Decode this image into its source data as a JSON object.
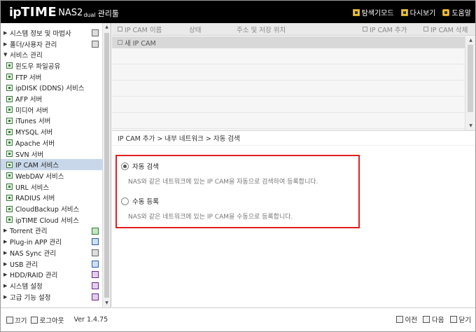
{
  "header": {
    "logo_ip": "ip",
    "logo_time": "TIME",
    "logo_nas": "NAS2",
    "logo_dual": "dual",
    "logo_mgr": "관리툴",
    "links": [
      {
        "label": "탐색기모드",
        "icon": "explorer-icon"
      },
      {
        "label": "다시보기",
        "icon": "refresh-icon"
      },
      {
        "label": "도움말",
        "icon": "help-icon"
      }
    ]
  },
  "sidebar": {
    "items": [
      {
        "label": "시스템 정보 및 마법사",
        "level": 1,
        "arrow": "▶",
        "icon": "chart-icon"
      },
      {
        "label": "폴더/사용자 관리",
        "level": 1,
        "arrow": "▶",
        "icon": "folder-icon"
      },
      {
        "label": "서비스 관리",
        "level": 1,
        "arrow": "▼"
      },
      {
        "label": "윈도우 파일공유",
        "level": 2
      },
      {
        "label": "FTP 서버",
        "level": 2
      },
      {
        "label": "ipDISK (DDNS) 서비스",
        "level": 2
      },
      {
        "label": "AFP 서버",
        "level": 2
      },
      {
        "label": "미디어 서버",
        "level": 2
      },
      {
        "label": "iTunes 서버",
        "level": 2
      },
      {
        "label": "MYSQL 서버",
        "level": 2
      },
      {
        "label": "Apache 서버",
        "level": 2
      },
      {
        "label": "SVN 서버",
        "level": 2
      },
      {
        "label": "IP CAM 서비스",
        "level": 2,
        "active": true
      },
      {
        "label": "WebDAV 서비스",
        "level": 2
      },
      {
        "label": "URL 서비스",
        "level": 2
      },
      {
        "label": "RADIUS 서버",
        "level": 2
      },
      {
        "label": "CloudBackup 서비스",
        "level": 2
      },
      {
        "label": "ipTIME Cloud 서비스",
        "level": 2
      },
      {
        "label": "Torrent 관리",
        "level": 1,
        "arrow": "▶",
        "icon": "torrent-icon"
      },
      {
        "label": "Plug-in APP 관리",
        "level": 1,
        "arrow": "▶",
        "icon": "plugin-icon"
      },
      {
        "label": "NAS Sync 관리",
        "level": 1,
        "arrow": "▶",
        "icon": "sync-icon"
      },
      {
        "label": "USB 관리",
        "level": 1,
        "arrow": "▶",
        "icon": "usb-icon"
      },
      {
        "label": "HDD/RAID 관리",
        "level": 1,
        "arrow": "▶",
        "icon": "hdd-icon"
      },
      {
        "label": "시스템 설정",
        "level": 1,
        "arrow": "▶",
        "icon": "settings-icon"
      },
      {
        "label": "고급 기능 설정",
        "level": 1,
        "arrow": "▶",
        "icon": "advanced-icon"
      }
    ]
  },
  "footer_left": {
    "power": "끄기",
    "logout": "로그아웃",
    "version": "Ver 1.4.75"
  },
  "camlist": {
    "col_name": "IP CAM 이름",
    "col_status": "상태",
    "col_addr": "주소 및 저장 위치",
    "add": "IP CAM 추가",
    "del": "IP CAM 삭제",
    "new_row": "새 IP CAM"
  },
  "breadcrumb": "IP CAM 추가 > 내부 네트워크 > 자동 검색",
  "options": [
    {
      "title": "자동 검색",
      "desc": "NAS와 같은 네트워크에 있는 IP CAM을 자동으로 검색하여 등록합니다.",
      "selected": true
    },
    {
      "title": "수동 등록",
      "desc": "NAS와 같은 네트워크에 있는 IP CAM을 수동으로 등록합니다.",
      "selected": false
    }
  ],
  "footer_right": {
    "prev": "이전",
    "next": "다음",
    "close": "닫기"
  }
}
